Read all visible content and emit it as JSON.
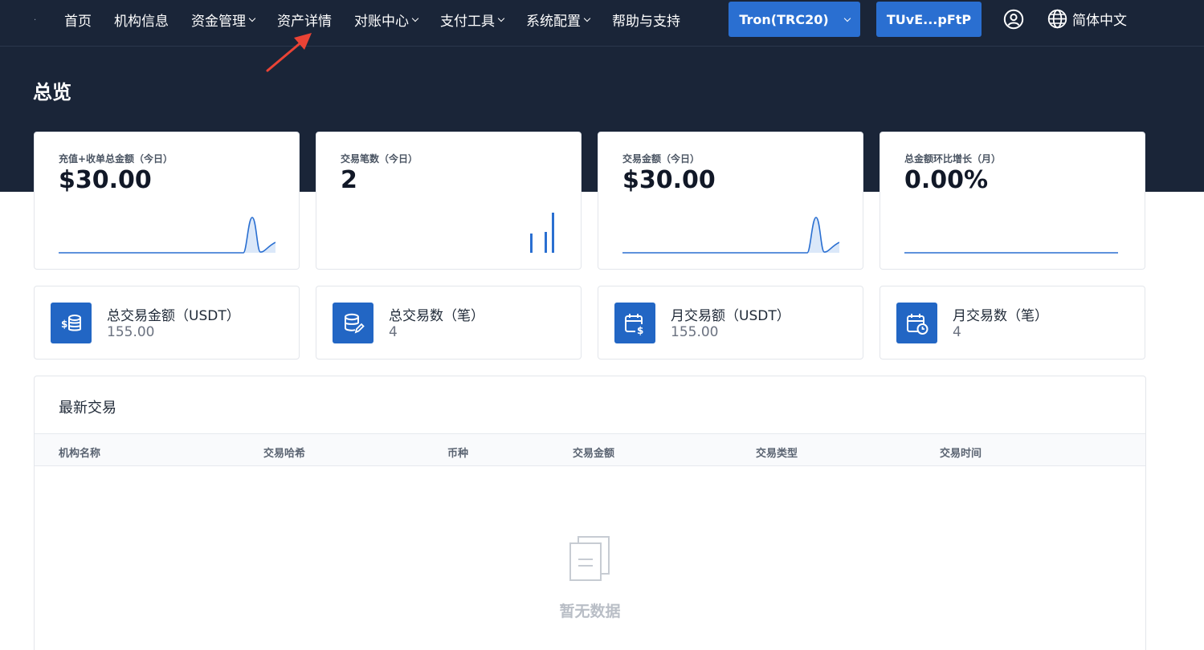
{
  "nav": {
    "dot": "·",
    "items": [
      {
        "label": "首页",
        "dropdown": false
      },
      {
        "label": "机构信息",
        "dropdown": false
      },
      {
        "label": "资金管理",
        "dropdown": true
      },
      {
        "label": "资产详情",
        "dropdown": false
      },
      {
        "label": "对账中心",
        "dropdown": true
      },
      {
        "label": "支付工具",
        "dropdown": true
      },
      {
        "label": "系统配置",
        "dropdown": true
      },
      {
        "label": "帮助与支持",
        "dropdown": false
      }
    ],
    "network_button": "Tron(TRC20)",
    "address_button": "TUvE...pFtP",
    "language": "简体中文"
  },
  "page": {
    "title": "总览"
  },
  "stats": [
    {
      "label": "充值+收单总金额（今日）",
      "value": "$30.00",
      "spark": "peak"
    },
    {
      "label": "交易笔数（今日）",
      "value": "2",
      "spark": "bars"
    },
    {
      "label": "交易金额（今日）",
      "value": "$30.00",
      "spark": "peak"
    },
    {
      "label": "总金额环比增长（月）",
      "value": "0.00%",
      "spark": "flat"
    }
  ],
  "info": [
    {
      "label": "总交易金额（USDT）",
      "value": "155.00",
      "icon": "coins-dollar-icon"
    },
    {
      "label": "总交易数（笔）",
      "value": "4",
      "icon": "database-edit-icon"
    },
    {
      "label": "月交易额（USDT）",
      "value": "155.00",
      "icon": "calendar-dollar-icon"
    },
    {
      "label": "月交易数（笔）",
      "value": "4",
      "icon": "calendar-clock-icon"
    }
  ],
  "transactions": {
    "title": "最新交易",
    "columns": [
      "机构名称",
      "交易哈希",
      "币种",
      "交易金额",
      "交易类型",
      "交易时间"
    ],
    "empty_text": "暂无数据"
  },
  "colors": {
    "header_bg": "#1a2538",
    "accent": "#2a6fd1",
    "annotation": "#ea4335"
  }
}
